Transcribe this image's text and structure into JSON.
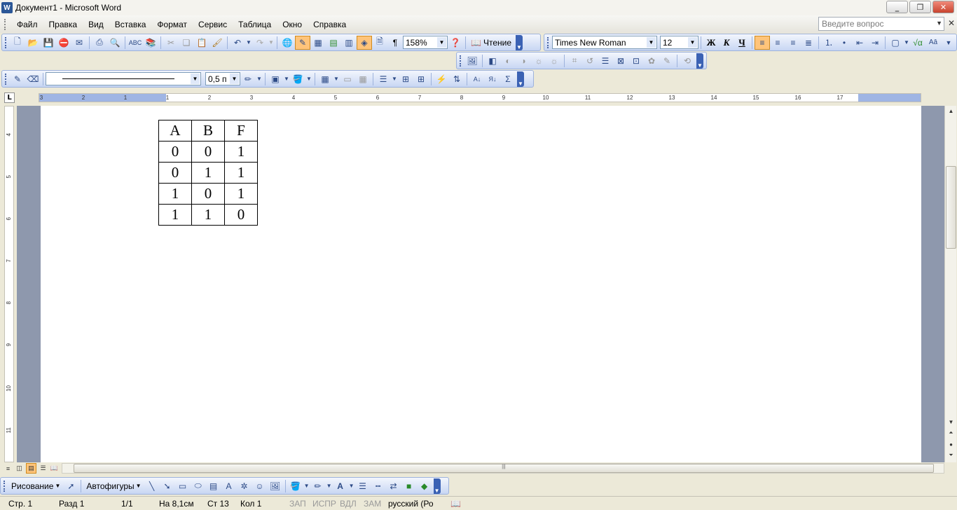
{
  "window": {
    "title": "Документ1 - Microsoft Word",
    "app_icon": "W",
    "buttons": [
      "_",
      "❐",
      "✕"
    ]
  },
  "menu": {
    "items": [
      "Файл",
      "Правка",
      "Вид",
      "Вставка",
      "Формат",
      "Сервис",
      "Таблица",
      "Окно",
      "Справка"
    ],
    "help_placeholder": "Введите вопрос",
    "close_doc": "✕"
  },
  "standard_toolbar": {
    "zoom": "158%",
    "reading_label": "Чтение",
    "paragraph_mark": "¶"
  },
  "formatting_toolbar": {
    "font": "Times New Roman",
    "size": "12",
    "bold": "Ж",
    "italic": "К",
    "underline": "Ч"
  },
  "tables_toolbar": {
    "line_width": "0,5 п",
    "sum_symbol": "Σ"
  },
  "ruler": {
    "tab_selector": "L",
    "horizontal_ticks": [
      "3",
      "2",
      "1",
      "1",
      "2",
      "3",
      "4",
      "5",
      "6",
      "7",
      "8",
      "9",
      "10",
      "11",
      "12",
      "13",
      "14",
      "15",
      "16",
      "17"
    ],
    "vertical_ticks": [
      "4",
      "5",
      "6",
      "7",
      "8",
      "9",
      "10",
      "11"
    ]
  },
  "document": {
    "table": {
      "header": [
        "A",
        "B",
        "F"
      ],
      "rows": [
        [
          "0",
          "0",
          "1"
        ],
        [
          "0",
          "1",
          "1"
        ],
        [
          "1",
          "0",
          "1"
        ],
        [
          "1",
          "1",
          "0"
        ]
      ]
    }
  },
  "drawing_toolbar": {
    "draw_label": "Рисование",
    "autoshapes_label": "Автофигуры"
  },
  "status": {
    "page": "Стр. 1",
    "section": "Разд 1",
    "pages": "1/1",
    "at": "На 8,1см",
    "line": "Ст 13",
    "col": "Кол 1",
    "rec": "ЗАП",
    "trk": "ИСПР",
    "ext": "ВДЛ",
    "ovr": "ЗАМ",
    "language": "русский (Ро"
  }
}
